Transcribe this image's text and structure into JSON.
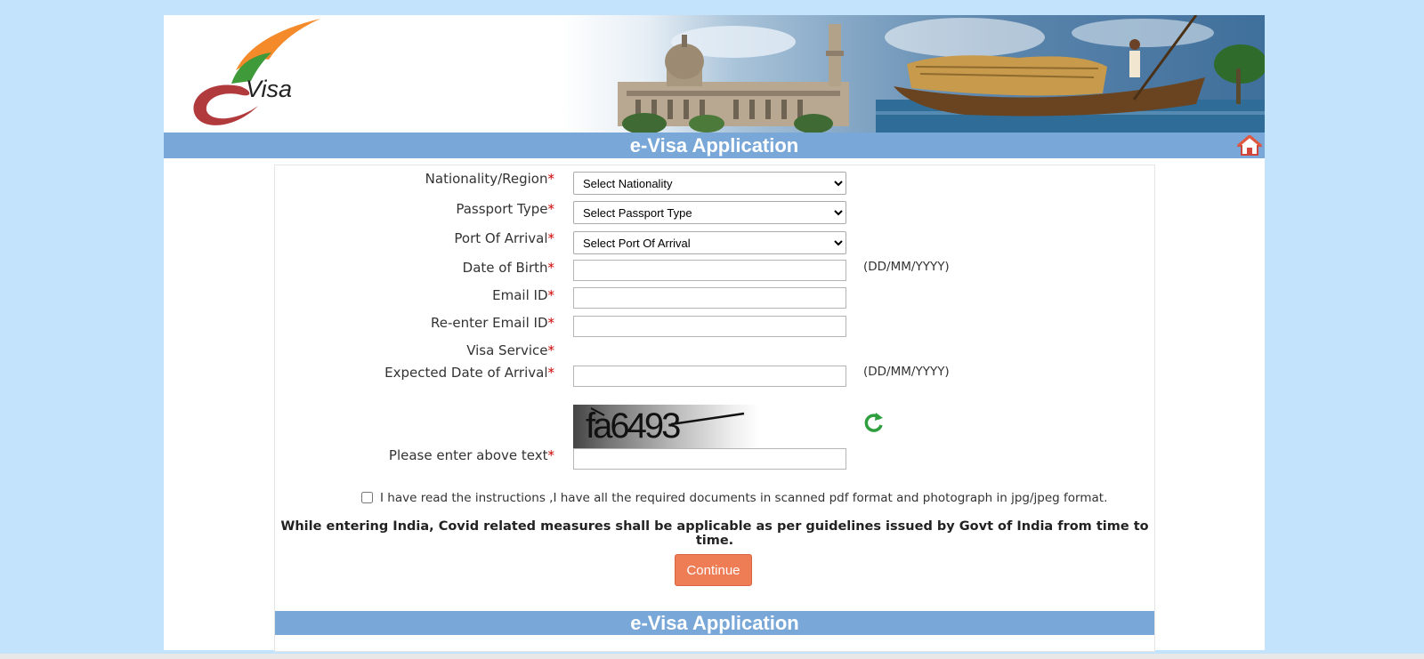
{
  "header": {
    "logo_text": "Visa",
    "title": "e-Visa Application"
  },
  "form": {
    "nationality": {
      "label": "Nationality/Region",
      "required_mark": "*",
      "selected": "Select Nationality"
    },
    "passport_type": {
      "label": "Passport Type",
      "required_mark": "*",
      "selected": "Select Passport Type"
    },
    "port_of_arrival": {
      "label": "Port Of Arrival",
      "required_mark": "*",
      "selected": "Select Port Of Arrival"
    },
    "date_of_birth": {
      "label": "Date of Birth",
      "required_mark": "*",
      "value": "",
      "hint": "(DD/MM/YYYY)"
    },
    "email": {
      "label": "Email ID",
      "required_mark": "*",
      "value": ""
    },
    "reenter_email": {
      "label": "Re-enter Email ID",
      "required_mark": "*",
      "value": ""
    },
    "visa_service": {
      "label": "Visa Service",
      "required_mark": "*"
    },
    "expected_arrival": {
      "label": "Expected Date of Arrival",
      "required_mark": "*",
      "value": "",
      "hint": "(DD/MM/YYYY)"
    },
    "captcha": {
      "text": "fa6493"
    },
    "captcha_input": {
      "label": "Please enter above text",
      "required_mark": "*",
      "value": ""
    },
    "instructions_checkbox": {
      "label": "I have read the instructions ,I have all the required documents in scanned pdf format and photograph in jpg/jpeg format.",
      "checked": false
    },
    "notice": "While entering India, Covid related measures shall be applicable as per guidelines issued by Govt of India from time to time.",
    "continue_label": "Continue"
  },
  "footer": {
    "title": "e-Visa Application"
  },
  "icons": {
    "home": "home-icon",
    "refresh": "refresh-icon"
  },
  "colors": {
    "page_bg": "#c3e2fb",
    "title_bar": "#79a8d8",
    "button": "#ee7c55",
    "required": "#cc0000",
    "refresh": "#2e9e3e"
  }
}
